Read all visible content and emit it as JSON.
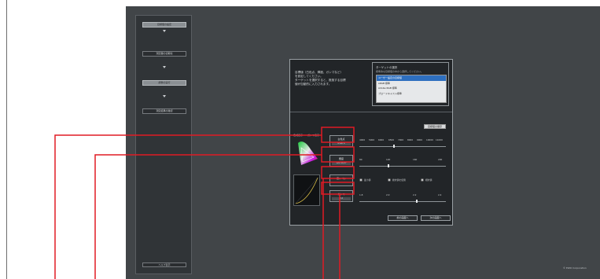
{
  "sidebar": {
    "steps": [
      "目標値の設定",
      "測定器の初期化",
      "調整の実行",
      "測定結果の確認"
    ],
    "bottom_label": "ヘルプ表示"
  },
  "dialog": {
    "info_lines": [
      "目標値（白色点、輝度、ガンマなど）",
      "を設定してください。",
      "ターゲットを選択すると、推奨する目標",
      "値が自動的に入力されます。"
    ],
    "reference": {
      "title": "ターゲットの選択",
      "subtitle": "標準的な目標値の中から選択してください。",
      "items": [
        "ユーザー設定の目標値",
        "sRGB 標準",
        "Adobe RGB 標準",
        "ブロードキャスト標準"
      ],
      "selected_index": 0
    },
    "preset_button": "目標値の保存",
    "column_headers": [
      "色域表示",
      "ガンマ表示"
    ],
    "params": [
      {
        "label": "白色点",
        "value": "6500 K"
      },
      {
        "label": "輝度",
        "value": "120 cd/m²"
      },
      {
        "label": "黒レベル",
        "value": ""
      },
      {
        "label": "ガンマ",
        "value": "2.2"
      }
    ],
    "white_ticks": [
      "4000",
      "5000",
      "6000",
      "6500",
      "7000",
      "8000",
      "9000",
      "10000",
      "11000"
    ],
    "luminance_ticks": [
      "80",
      "120",
      "160",
      "200"
    ],
    "black_options": [
      "最小値",
      "絶対値を使用",
      "相対値"
    ],
    "gamma_ticks": [
      "1.8",
      "2.0",
      "2.2",
      "2.4"
    ],
    "footer_buttons": [
      "前の画面へ",
      "次の画面へ"
    ]
  },
  "levels": {
    "white_point": 0.4,
    "luminance": 0.33,
    "gamma": 0.67
  },
  "copyright": "© EIZO Corporation",
  "colors": {
    "callout_red": "#e01b24",
    "screen_bg": "#414548",
    "dialog_bg": "#222528",
    "selection": "#2e6fbf"
  }
}
